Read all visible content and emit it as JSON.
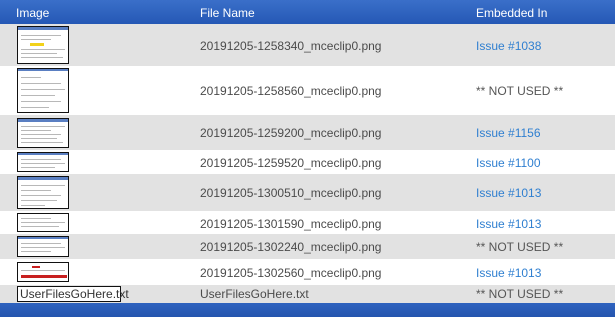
{
  "header": {
    "image_label": "Image",
    "file_label": "File Name",
    "embedded_label": "Embedded In"
  },
  "rows": [
    {
      "file": "20191205-1258340_mceclip0.png",
      "embedded": "Issue #1038",
      "used": true
    },
    {
      "file": "20191205-1258560_mceclip0.png",
      "embedded": "** NOT USED **",
      "used": false
    },
    {
      "file": "20191205-1259200_mceclip0.png",
      "embedded": "Issue #1156",
      "used": true
    },
    {
      "file": "20191205-1259520_mceclip0.png",
      "embedded": "Issue #1100",
      "used": true
    },
    {
      "file": "20191205-1300510_mceclip0.png",
      "embedded": "Issue #1013",
      "used": true
    },
    {
      "file": "20191205-1301590_mceclip0.png",
      "embedded": "Issue #1013",
      "used": true
    },
    {
      "file": "20191205-1302240_mceclip0.png",
      "embedded": "** NOT USED **",
      "used": false
    },
    {
      "file": "20191205-1302560_mceclip0.png",
      "embedded": "Issue #1013",
      "used": true
    },
    {
      "file": "UserFilesGoHere.txt",
      "embedded": "** NOT USED **",
      "used": false,
      "thumb_text": "UserFilesGoHere.txt"
    }
  ],
  "colors": {
    "header_bg": "#2b5fbd",
    "row_shaded": "#e2e2e2",
    "link": "#2f7fd0"
  }
}
